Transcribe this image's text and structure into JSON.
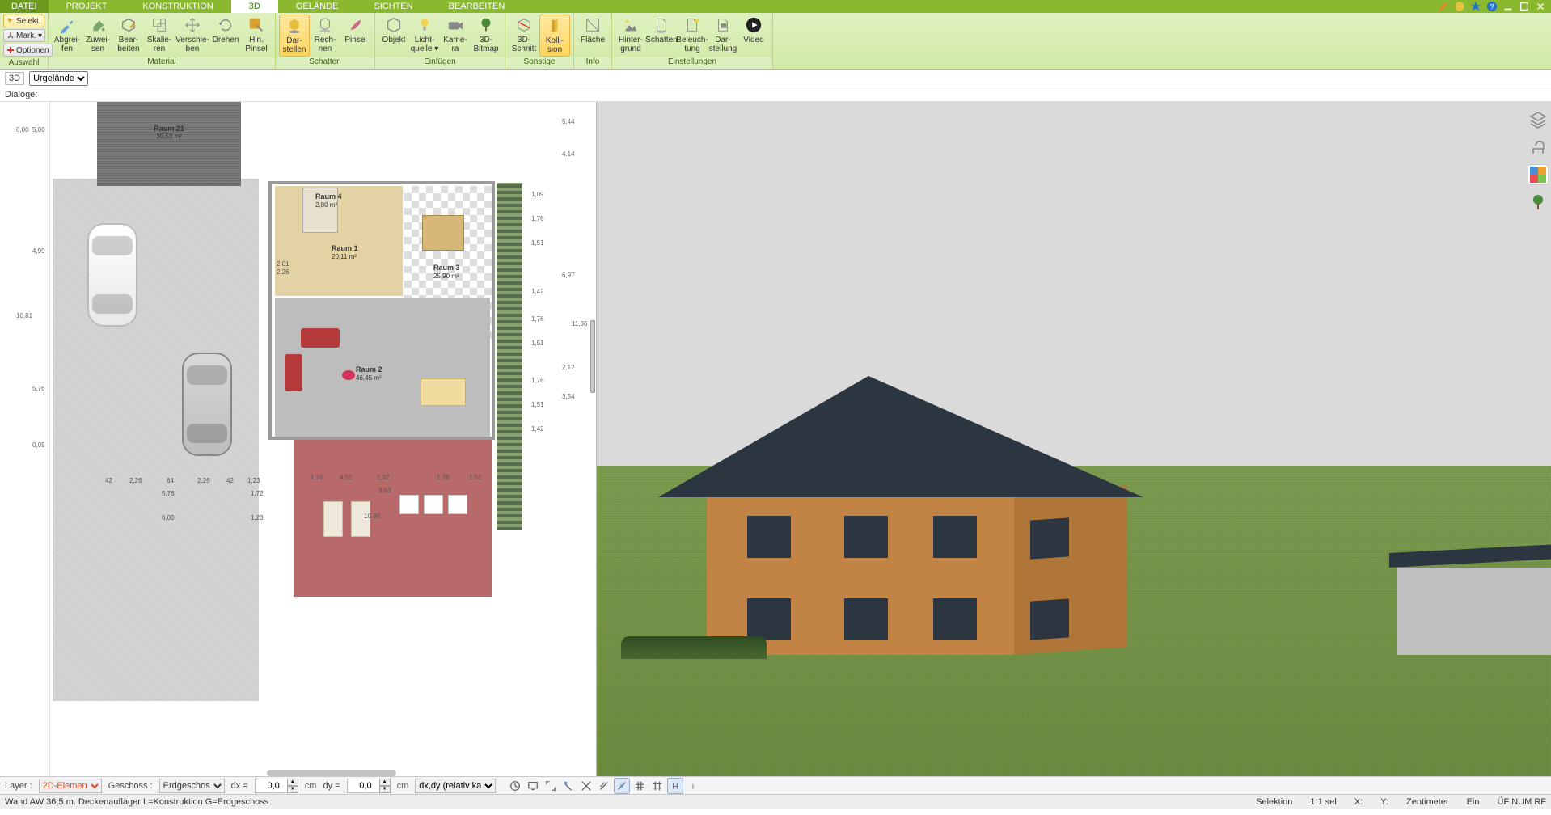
{
  "tabs": {
    "file": "DATEI",
    "projekt": "PROJEKT",
    "konstruktion": "KONSTRUKTION",
    "threeD": "3D",
    "gelaende": "GELÄNDE",
    "sichten": "SICHTEN",
    "bearbeiten": "BEARBEITEN"
  },
  "ribbon": {
    "left": {
      "selekt": "Selekt.",
      "mark": "Mark.",
      "optionen": "Optionen",
      "group": "Auswahl"
    },
    "material": {
      "abgreifen": "Abgrei-\nfen",
      "zuweisen": "Zuwei-\nsen",
      "bearbeiten": "Bear-\nbeiten",
      "skalieren": "Skalie-\nren",
      "verschieben": "Verschie-\nben",
      "drehen": "Drehen",
      "hinpinsel": "Hin.\nPinsel",
      "group": "Material"
    },
    "schatten": {
      "darstellen": "Dar-\nstellen",
      "rechnen": "Rech-\nnen",
      "pinsel": "Pinsel",
      "group": "Schatten"
    },
    "einfuegen": {
      "objekt": "Objekt",
      "lichtquelle": "Licht-\nquelle ▾",
      "kamera": "Kame-\nra",
      "bitmap": "3D-\nBitmap",
      "group": "Einfügen"
    },
    "sonstige": {
      "schnitt": "3D-\nSchnitt",
      "kollision": "Kolli-\nsion",
      "group": "Sonstige"
    },
    "info": {
      "flaeche": "Fläche",
      "group": "Info"
    },
    "einstellungen": {
      "hintergrund": "Hinter-\ngrund",
      "schatten": "Schatten",
      "beleuchtung": "Beleuch-\ntung",
      "darstellung": "Dar-\nstellung",
      "video": "Video",
      "group": "Einstellungen"
    }
  },
  "subbar": {
    "mode": "3D",
    "layer": "Urgelände"
  },
  "dialoge": {
    "label": "Dialoge:"
  },
  "floorplan": {
    "rooms": {
      "r21": {
        "name": "Raum 21",
        "area": "30,53 m²"
      },
      "r4": {
        "name": "Raum 4",
        "area": "2,80 m²"
      },
      "r1": {
        "name": "Raum 1",
        "area": "20,11 m²"
      },
      "r3": {
        "name": "Raum 3",
        "area": "25,90 m²"
      },
      "r2": {
        "name": "Raum 2",
        "area": "46,45 m²"
      }
    },
    "dims_left": [
      "6,00",
      "5,00",
      "4,99",
      "10,81",
      "5,76",
      "0,05"
    ],
    "dims_right_outer": [
      "5,44",
      "4,14",
      "6,97",
      "11,36",
      "2,12",
      "3,54"
    ],
    "dims_right_inner": [
      "1,09",
      "1,76",
      "1,51",
      "1,42",
      "1,76",
      "1,51",
      "1,76",
      "1,51",
      "1,42"
    ],
    "dims_bottom": [
      "2,26",
      "2,26",
      "1,23",
      "5,76",
      "6,00",
      "42",
      "64",
      "42",
      "1,72",
      "1,23"
    ],
    "dims_terrace": [
      "1,76",
      "4,51",
      "2,32",
      "9,63",
      "10,36",
      "1,76",
      "1,51"
    ],
    "door_dims": [
      "2,01",
      "2,26"
    ]
  },
  "vtoolbar": {
    "layers": "layers",
    "chair": "furniture",
    "palette": "materials",
    "tree": "plants"
  },
  "bottombar": {
    "layer_label": "Layer :",
    "layer_value": "2D-Elemen",
    "geschoss_label": "Geschoss :",
    "geschoss_value": "Erdgeschos",
    "dx_label": "dx =",
    "dx_value": "0,0",
    "dx_unit": "cm",
    "dy_label": "dy =",
    "dy_value": "0,0",
    "dy_unit": "cm",
    "rel": "dx,dy (relativ ka"
  },
  "statusbar": {
    "left": "Wand AW 36,5 m. Deckenauflager  L=Konstruktion  G=Erdgeschoss",
    "selektion": "Selektion",
    "scale": "1:1 sel",
    "X": "X:",
    "Y": "Y:",
    "unit": "Zentimeter",
    "ein": "Ein",
    "flags": "ÜF NUM RF"
  }
}
